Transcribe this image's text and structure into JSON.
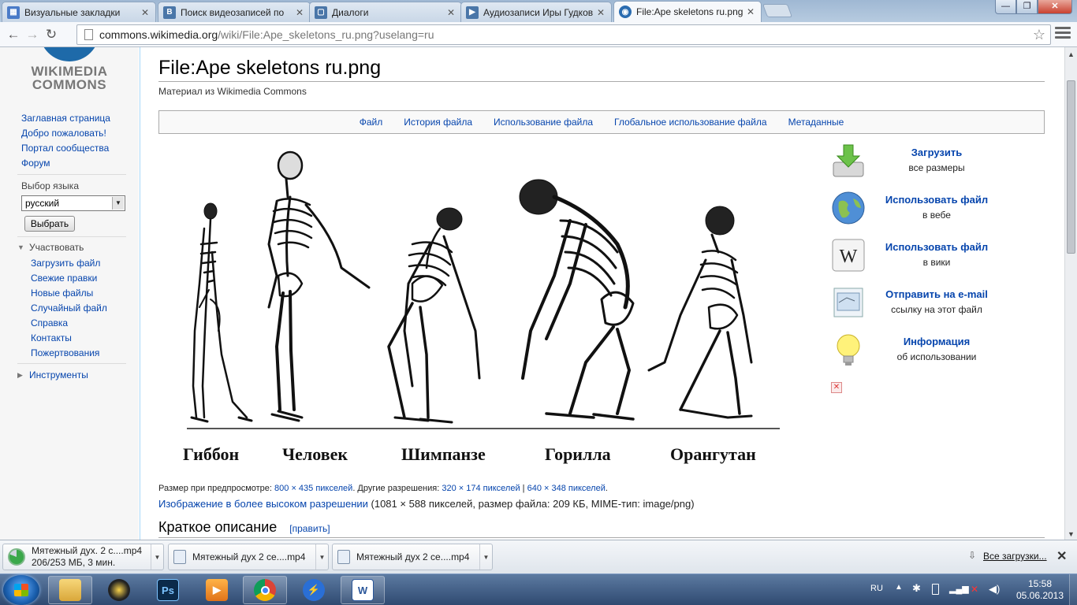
{
  "tabs": [
    {
      "title": "Визуальные закладки",
      "favcolor": "#4a7bc8",
      "fav": "▦"
    },
    {
      "title": "Поиск видеозаписей по",
      "favcolor": "#4a76a8",
      "fav": "В"
    },
    {
      "title": "Диалоги",
      "favcolor": "#4a76a8",
      "fav": "▢"
    },
    {
      "title": "Аудиозаписи Иры Гудков",
      "favcolor": "#4a76a8",
      "fav": "▶"
    },
    {
      "title": "File:Ape skeletons ru.png -",
      "favcolor": "#2b6cb0",
      "fav": "◉"
    }
  ],
  "address": {
    "host": "commons.wikimedia.org",
    "rest": "/wiki/File:Ape_skeletons_ru.png?uselang=ru"
  },
  "sidebar": {
    "logo_line1": "WIKIMEDIA",
    "logo_line2": "COMMONS",
    "nav": [
      "Заглавная страница",
      "Добро пожаловать!",
      "Портал сообщества",
      "Форум"
    ],
    "lang_label": "Выбор языка",
    "lang_value": "русский",
    "lang_button": "Выбрать",
    "participate_header": "Участвовать",
    "participate": [
      "Загрузить файл",
      "Свежие правки",
      "Новые файлы",
      "Случайный файл",
      "Справка",
      "Контакты",
      "Пожертвования"
    ],
    "tools_header": "Инструменты"
  },
  "page": {
    "title": "File:Ape skeletons ru.png",
    "subtitle": "Материал из Wikimedia Commons",
    "toc": [
      "Файл",
      "История файла",
      "Использование файла",
      "Глобальное использование файла",
      "Метаданные"
    ],
    "captions": [
      "Гиббон",
      "Человек",
      "Шимпанзе",
      "Горилла",
      "Орангутан"
    ],
    "size_label": "Размер при предпросмотре: ",
    "size_link": "800 × 435 пикселей",
    "other_label": ". Другие разрешения: ",
    "res1": "320 × 174 пикселей",
    "sep": " | ",
    "res2": "640 × 348 пикселей",
    "end": ".",
    "hires_link": "Изображение в более высоком разрешении",
    "hires_info": " (1081 × 588 пикселей, размер файла: 209 КБ, MIME-тип: image/png)",
    "section": "Краткое описание",
    "edit": "[править]"
  },
  "downloadbar": [
    {
      "t1": "Загрузить",
      "t2": "все размеры",
      "icon": "download-icon"
    },
    {
      "t1": "Использовать файл",
      "t2": "в вебе",
      "icon": "globe-icon"
    },
    {
      "t1": "Использовать файл",
      "t2": "в вики",
      "icon": "wikipedia-icon"
    },
    {
      "t1": "Отправить на e-mail",
      "t2": "ссылку на этот файл",
      "icon": "email-icon"
    },
    {
      "t1": "Информация",
      "t2": "об использовании",
      "icon": "lightbulb-icon"
    }
  ],
  "downloads": [
    {
      "name": "Мятежный дух. 2 с....mp4",
      "status": "206/253 МБ, 3 мин."
    },
    {
      "name": "Мятежный дух 2 се....mp4"
    },
    {
      "name": "Мятежный дух 2 се....mp4"
    }
  ],
  "all_downloads": "Все загрузки...",
  "tray": {
    "lang": "RU",
    "time": "15:58",
    "date": "05.06.2013"
  }
}
